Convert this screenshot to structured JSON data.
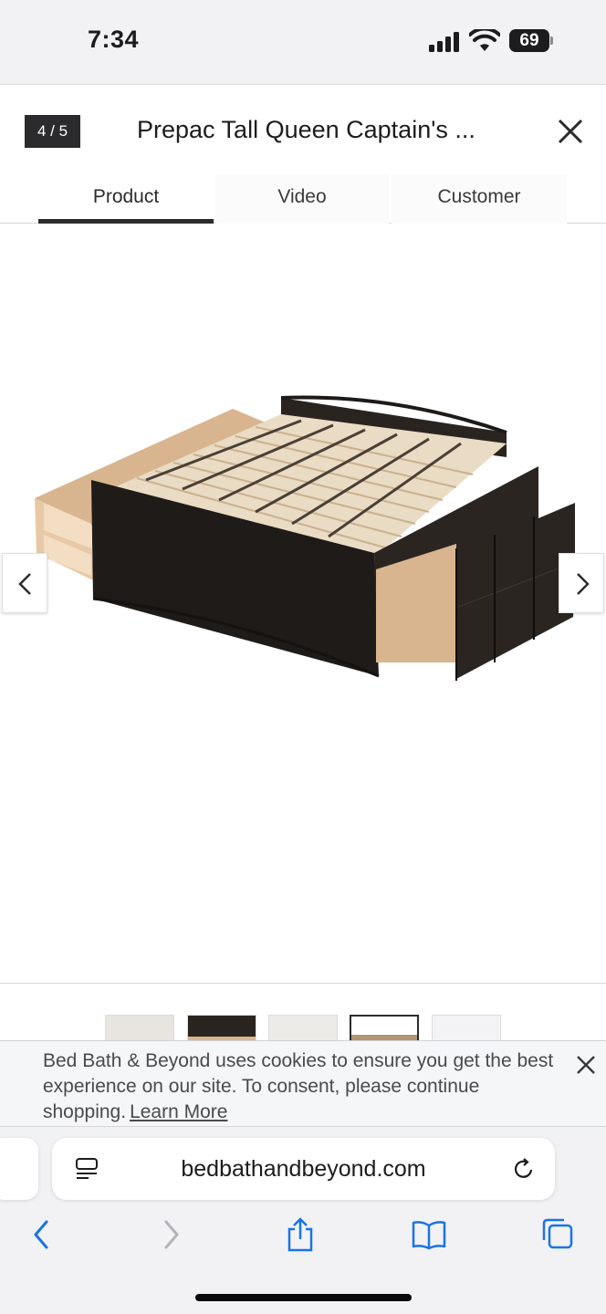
{
  "status_bar": {
    "time": "7:34",
    "battery": "69",
    "icons": [
      "signal-icon",
      "wifi-icon",
      "battery-icon"
    ]
  },
  "modal": {
    "counter": "4 / 5",
    "title": "Prepac Tall Queen Captain's ...",
    "tabs": [
      {
        "label": "Product",
        "active": true
      },
      {
        "label": "Video",
        "active": false
      },
      {
        "label": "Customer",
        "active": false
      }
    ],
    "image_alt_icon": "bed-with-drawers-image",
    "thumbnails_count": 5,
    "selected_thumbnail": 4
  },
  "cookie_banner": {
    "text": "Bed Bath & Beyond uses cookies to ensure you get the best experience on our site. To consent, please continue shopping.",
    "link_text": "Learn More"
  },
  "browser": {
    "url": "bedbathandbeyond.com",
    "toolbar": [
      "back-icon",
      "forward-icon",
      "share-icon",
      "bookmarks-icon",
      "tabs-icon"
    ]
  },
  "colors": {
    "accent_dark": "#2b2b2d",
    "link_blue": "#1a73e8"
  }
}
